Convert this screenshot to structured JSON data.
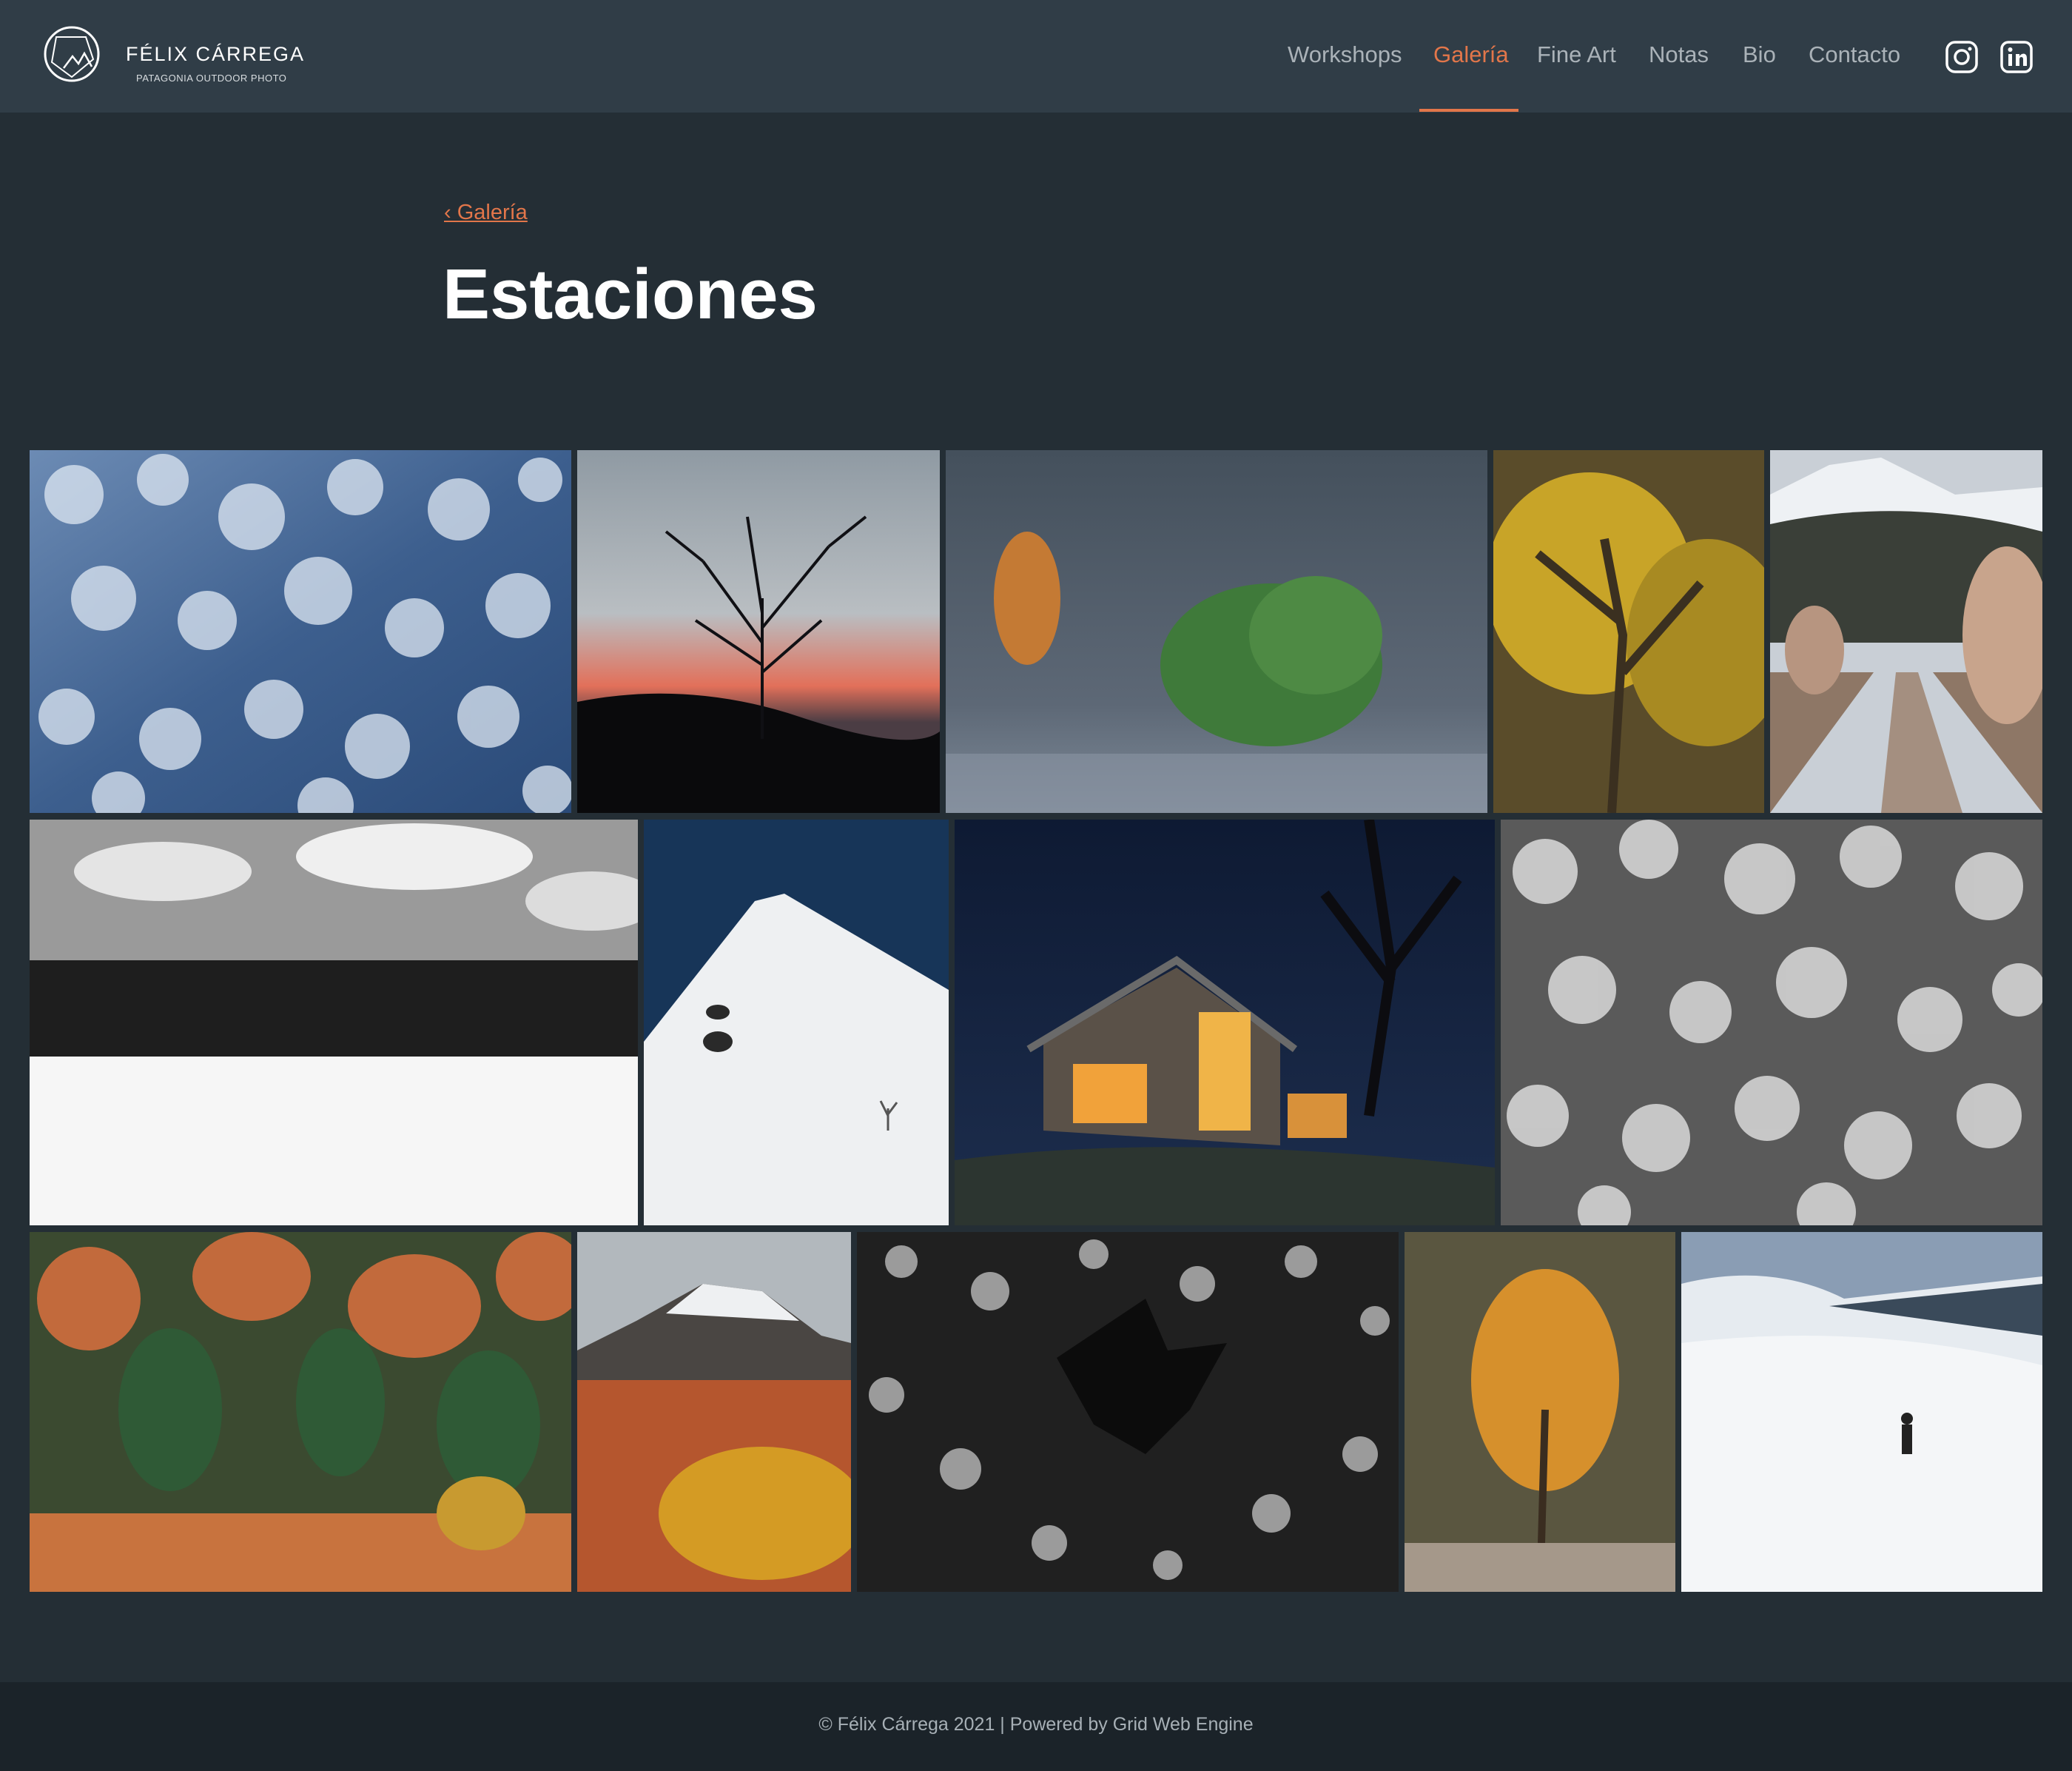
{
  "site": {
    "name": "FÉLIX CÁRREGA",
    "tagline": "PATAGONIA OUTDOOR PHOTO"
  },
  "nav": {
    "items": [
      {
        "label": "Workshops"
      },
      {
        "label": "Galería",
        "active": true
      },
      {
        "label": "Fine Art"
      },
      {
        "label": "Notas"
      },
      {
        "label": "Bio"
      },
      {
        "label": "Contacto"
      }
    ],
    "social": [
      "instagram-icon",
      "linkedin-icon"
    ]
  },
  "breadcrumb": {
    "label": "‹ Galería"
  },
  "page": {
    "title": "Estaciones"
  },
  "colors": {
    "header_bg": "#303d47",
    "page_bg": "#242e35",
    "footer_bg": "#1b2329",
    "accent": "#e2764a"
  },
  "gallery": {
    "photos": [
      "Snow-covered forest from above",
      "Bare tree silhouette at sunset",
      "Misty hillside with green tree",
      "Golden autumn tree",
      "Tree-lined road with mountain",
      "Black and white snowy field with forest",
      "Snowy peak against blue sky",
      "Wooden cabin lit at night",
      "Black and white frosted trees",
      "Autumn forest",
      "Mountain with autumn shrubs",
      "Black and white leaf on grass",
      "Orange autumn tree",
      "Skier on snowy slope"
    ]
  },
  "footer": {
    "text": "© Félix Cárrega 2021 | Powered by Grid Web Engine"
  }
}
